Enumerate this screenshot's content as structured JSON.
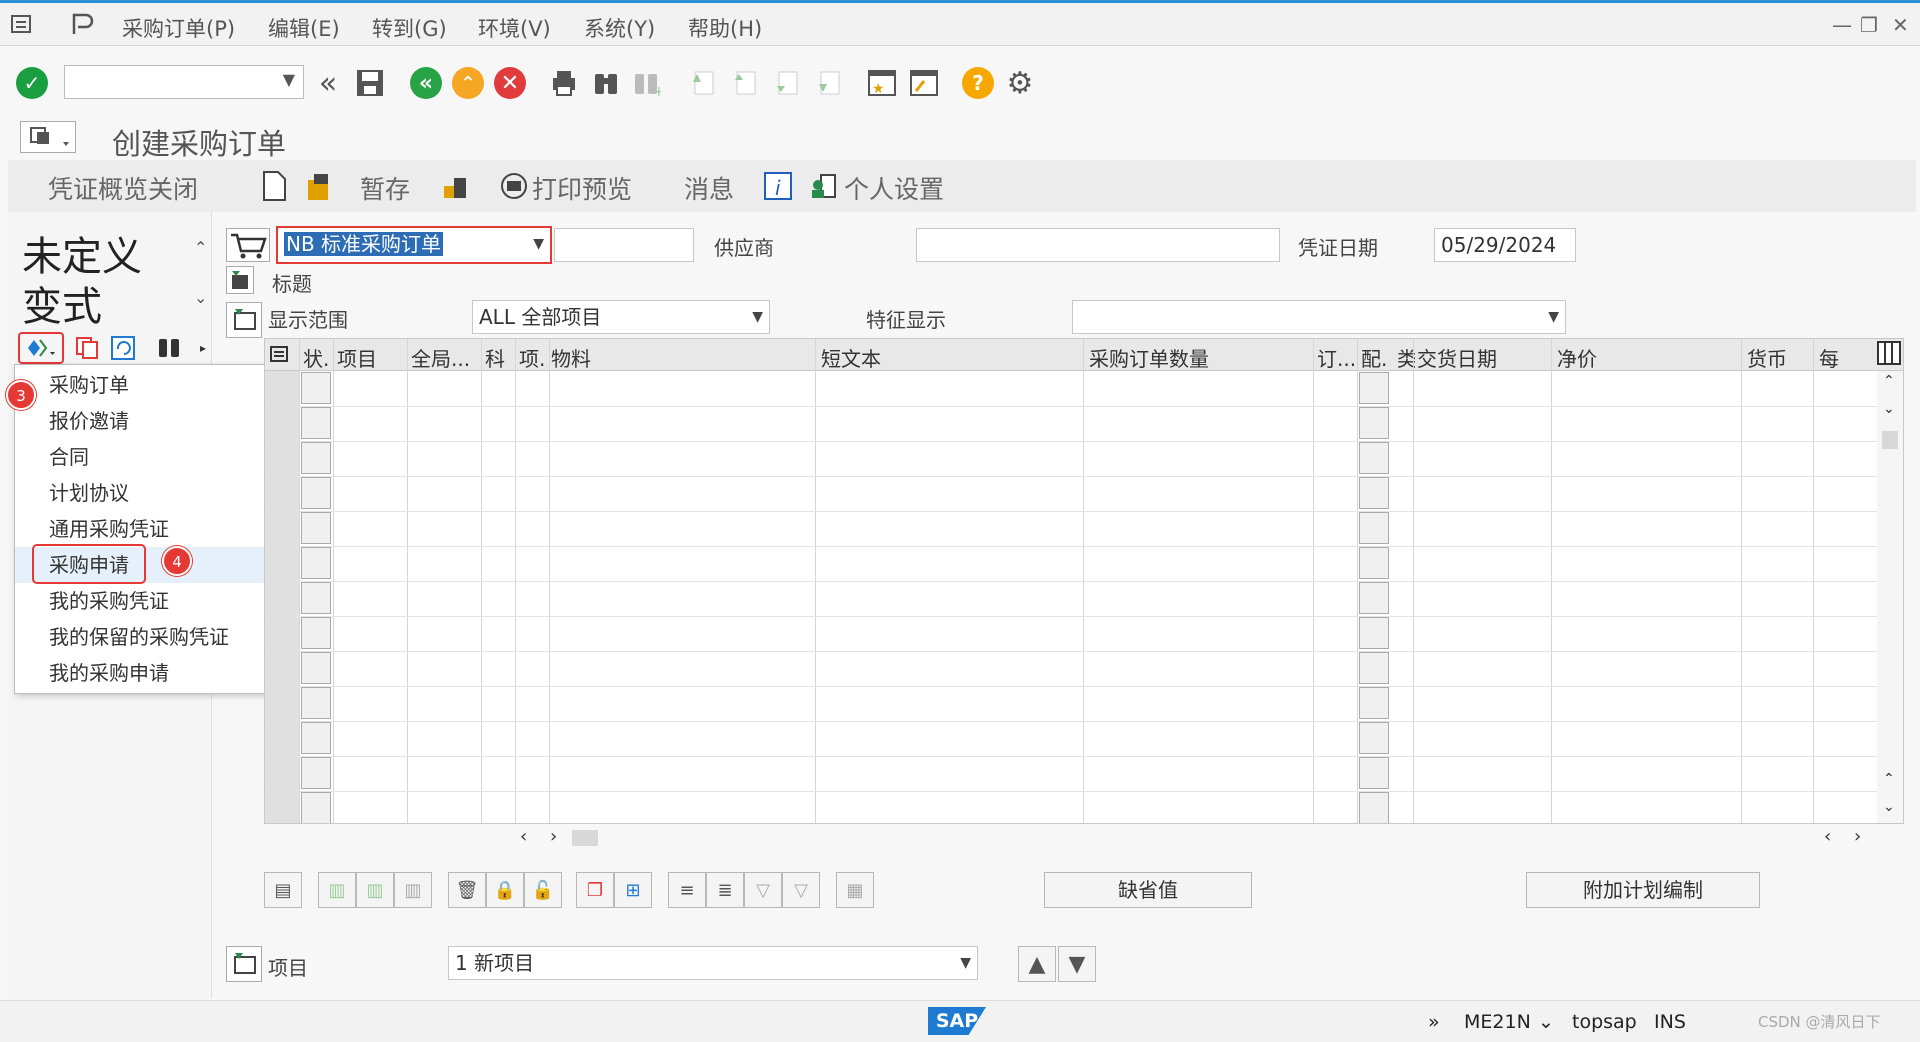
{
  "menu": {
    "items": [
      "采购订单(P)",
      "编辑(E)",
      "转到(G)",
      "环境(V)",
      "系统(Y)",
      "帮助(H)"
    ]
  },
  "window_controls": [
    "—",
    "❐",
    "✕"
  ],
  "title": "创建采购订单",
  "app_toolbar": {
    "doc_overview_off": "凭证概览关闭",
    "hold": "暂存",
    "print_preview": "打印预览",
    "messages": "消息",
    "personal_settings": "个人设置"
  },
  "left_pane": {
    "variant": "未定义变式"
  },
  "dropdown": {
    "options": [
      "采购订单",
      "报价邀请",
      "合同",
      "计划协议",
      "通用采购凭证",
      "采购申请",
      "我的采购凭证",
      "我的保留的采购凭证",
      "我的采购申请"
    ],
    "highlighted_index": 5
  },
  "badges": {
    "step3": "3",
    "step4": "4"
  },
  "header": {
    "order_type": "NB 标准采购订单",
    "vendor_label": "供应商",
    "vendor_value": "",
    "doc_date_label": "凭证日期",
    "doc_date_value": "05/29/2024",
    "header_label": "标题",
    "display_range_label": "显示范围",
    "display_range_value": "ALL 全部项目",
    "feature_label": "特征显示",
    "feature_value": ""
  },
  "grid": {
    "columns": [
      "状.",
      "项目",
      "全局...",
      "科",
      "项.",
      "物料",
      "短文本",
      "采购订单数量",
      "订...",
      "配.",
      "类",
      "交货日期",
      "净价",
      "货币",
      "每"
    ],
    "row_count": 13
  },
  "buttons": {
    "defaults": "缺省值",
    "extra_planning": "附加计划编制"
  },
  "item_row": {
    "label": "项目",
    "value": "1 新项目"
  },
  "status": {
    "transaction": "ME21N",
    "system": "topsap",
    "mode": "INS",
    "logo": "SAP",
    "watermark": "CSDN @清风日下"
  },
  "colors": {
    "accent": "#2d8fd5",
    "ok_green": "#1a9e3f",
    "nav_green": "#27a345",
    "up_orange": "#f5a623",
    "cancel_red": "#e03c3c",
    "help_orange": "#f6a800",
    "highlight_red": "#e53935"
  }
}
